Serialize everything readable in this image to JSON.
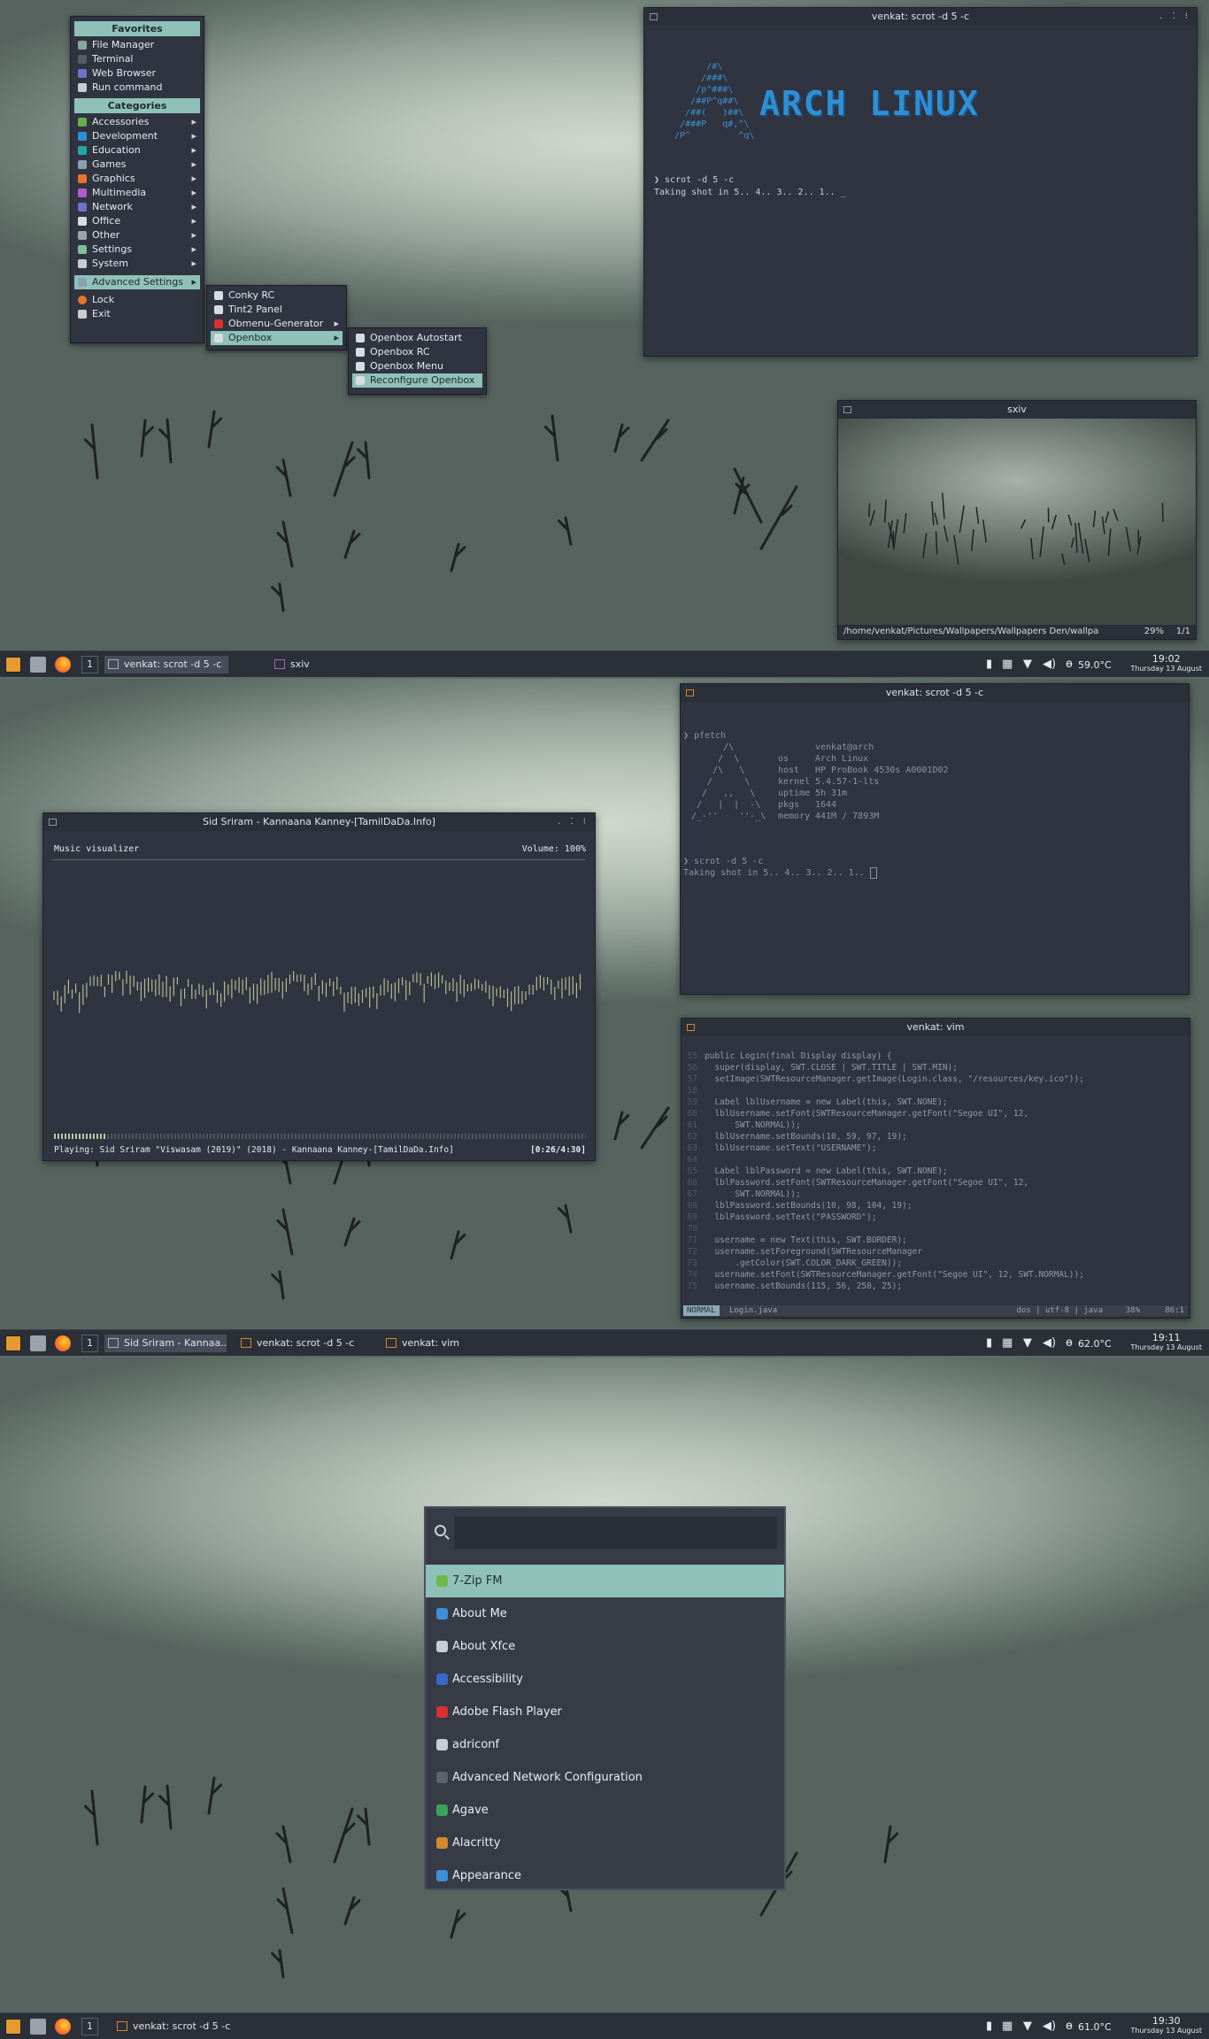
{
  "screen1": {
    "favorites_header": "Favorites",
    "favorites": [
      {
        "label": "File Manager",
        "icon": "folder-icon",
        "color": "#8aa59b"
      },
      {
        "label": "Terminal",
        "icon": "terminal-icon",
        "color": "#555c66"
      },
      {
        "label": "Web Browser",
        "icon": "globe-icon",
        "color": "#6e72c9"
      },
      {
        "label": "Run command",
        "icon": "gears-icon",
        "color": "#c7ccd2"
      }
    ],
    "categories_header": "Categories",
    "categories": [
      {
        "label": "Accessories",
        "color": "#66b04a"
      },
      {
        "label": "Development",
        "color": "#2e8fd8"
      },
      {
        "label": "Education",
        "color": "#23a6a0"
      },
      {
        "label": "Games",
        "color": "#8aa0b2"
      },
      {
        "label": "Graphics",
        "color": "#e8732a"
      },
      {
        "label": "Multimedia",
        "color": "#b55ac8"
      },
      {
        "label": "Network",
        "color": "#6e72c9"
      },
      {
        "label": "Office",
        "color": "#d9dcdf"
      },
      {
        "label": "Other",
        "color": "#9aa2ac"
      },
      {
        "label": "Settings",
        "color": "#7cbf96"
      },
      {
        "label": "System",
        "color": "#c7ccd2"
      }
    ],
    "advanced": "Advanced Settings",
    "lock": "Lock",
    "exit": "Exit",
    "submenu1": [
      "Conky RC",
      "Tint2 Panel",
      "Obmenu-Generator",
      "Openbox"
    ],
    "submenu2": [
      "Openbox Autostart",
      "Openbox RC",
      "Openbox Menu",
      "Reconfigure Openbox"
    ],
    "term_title": "venkat: scrot -d 5 -c",
    "arch_ascii": "         /#\\\n        /###\\\n       /p^###\\\n      /##P^q##\\\n     /##(   )##\\\n    /###P   q#,^\\\n   /P^         ^q\\",
    "arch_logo": "ARCH LINUX",
    "term_prompt": "❯ scrot -d 5 -c",
    "term_out": "Taking shot in 5.. 4.. 3.. 2.. 1.. ",
    "sxiv_title": "sxiv",
    "sxiv_status_path": "/home/venkat/Pictures/Wallpapers/Wallpapers Den/wallpa",
    "sxiv_status_zoom": "29%",
    "sxiv_status_pos": "1/1"
  },
  "panel1": {
    "workspace": "1",
    "tasks": [
      "venkat: scrot -d 5 -c",
      "sxiv"
    ],
    "temp": "59.0°C",
    "time": "19:02",
    "date": "Thursday 13 August"
  },
  "screen2": {
    "music_title": "Sid Sriram - Kannaana Kanney-[TamilDaDa.Info]",
    "visualizer_label": "Music visualizer",
    "volume": "Volume: 100%",
    "playing": "Playing: Sid Sriram \"Viswasam (2019)\" (2018) - Kannaana Kanney-[TamilDaDa.Info]",
    "time_pos": "[0:26/4:30]",
    "progress": 0.097,
    "pfetch_title": "venkat: scrot -d 5 -c",
    "pfetch_cmd": "❯ pfetch",
    "pfetch_logo": "       /\\\n      /  \\\n     /\\   \\\n    /      \\\n   /   ,,   \\\n  /   |  |  -\\\n /_-''    ''-_\\",
    "pfetch_info": [
      [
        "",
        "venkat@arch"
      ],
      [
        "os",
        "Arch Linux"
      ],
      [
        "host",
        "HP ProBook 4530s A0001D02"
      ],
      [
        "kernel",
        "5.4.57-1-lts"
      ],
      [
        "uptime",
        "5h 31m"
      ],
      [
        "pkgs",
        "1644"
      ],
      [
        "memory",
        "441M / 7893M"
      ]
    ],
    "pfetch_prompt": "❯ scrot -d 5 -c",
    "pfetch_out": "Taking shot in 5.. 4.. 3.. 2.. 1.. ",
    "vim_title": "venkat: vim",
    "vim_lines": [
      "public Login(final Display display) {",
      "  super(display, SWT.CLOSE | SWT.TITLE | SWT.MIN);",
      "  setImage(SWTResourceManager.getImage(Login.class, \"/resources/key.ico\"));",
      "",
      "  Label lblUsername = new Label(this, SWT.NONE);",
      "  lblUsername.setFont(SWTResourceManager.getFont(\"Segoe UI\", 12,",
      "      SWT.NORMAL));",
      "  lblUsername.setBounds(10, 59, 97, 19);",
      "  lblUsername.setText(\"USERNAME\");",
      "",
      "  Label lblPassword = new Label(this, SWT.NONE);",
      "  lblPassword.setFont(SWTResourceManager.getFont(\"Segoe UI\", 12,",
      "      SWT.NORMAL));",
      "  lblPassword.setBounds(10, 98, 104, 19);",
      "  lblPassword.setText(\"PASSWORD\");",
      "",
      "  username = new Text(this, SWT.BORDER);",
      "  username.setForeground(SWTResourceManager",
      "      .getColor(SWT.COLOR_DARK_GREEN));",
      "  username.setFont(SWTResourceManager.getFont(\"Segoe UI\", 12, SWT.NORMAL));",
      "  username.setBounds(115, 56, 250, 25);"
    ],
    "vim_mode": "NORMAL",
    "vim_file": "Login.java",
    "vim_info": "dos | utf-8 | java",
    "vim_pct": "38%",
    "vim_pos": "86:1"
  },
  "panel2": {
    "workspace": "1",
    "tasks": [
      "Sid Sriram - Kannaa...",
      "venkat: scrot -d 5 -c",
      "venkat: vim"
    ],
    "temp": "62.0°C",
    "time": "19:11",
    "date": "Thursday 13 August"
  },
  "screen3": {
    "search_value": "",
    "apps": [
      {
        "label": "7-Zip FM",
        "color": "#6cba47"
      },
      {
        "label": "About Me",
        "color": "#3d8fd8"
      },
      {
        "label": "About Xfce",
        "color": "#c8cdd3"
      },
      {
        "label": "Accessibility",
        "color": "#3a67c7"
      },
      {
        "label": "Adobe Flash Player",
        "color": "#d8322e"
      },
      {
        "label": "adriconf",
        "color": "#c9ced4"
      },
      {
        "label": "Advanced Network Configuration",
        "color": "#5b626c"
      },
      {
        "label": "Agave",
        "color": "#3aa35b"
      },
      {
        "label": "Alacritty",
        "color": "#d18a2e"
      },
      {
        "label": "Appearance",
        "color": "#3d8fd8"
      }
    ]
  },
  "panel3": {
    "workspace": "1",
    "tasks": [
      "venkat: scrot -d 5 -c"
    ],
    "temp": "61.0°C",
    "time": "19:30",
    "date": "Thursday 13 August"
  }
}
